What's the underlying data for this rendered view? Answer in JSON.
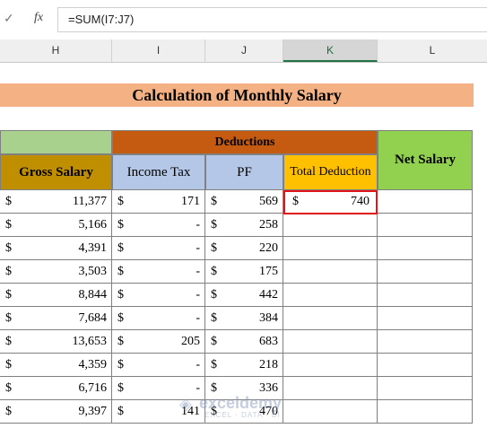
{
  "formula_bar": {
    "cancel_icon": "✓",
    "fx_label": "fx",
    "formula": "=SUM(I7:J7)"
  },
  "columns": [
    "H",
    "I",
    "J",
    "K",
    "L"
  ],
  "active_column": "K",
  "title": "Calculation of Monthly Salary",
  "headers": {
    "deductions": "Deductions",
    "net_salary": "Net Salary",
    "gross_salary": "Gross Salary",
    "income_tax": "Income Tax",
    "pf": "PF",
    "total_deduction": "Total Deduction"
  },
  "currency_symbol": "$",
  "rows": [
    {
      "gross": "11,377",
      "tax": "171",
      "pf": "569",
      "total": "740"
    },
    {
      "gross": "5,166",
      "tax": "-",
      "pf": "258",
      "total": ""
    },
    {
      "gross": "4,391",
      "tax": "-",
      "pf": "220",
      "total": ""
    },
    {
      "gross": "3,503",
      "tax": "-",
      "pf": "175",
      "total": ""
    },
    {
      "gross": "8,844",
      "tax": "-",
      "pf": "442",
      "total": ""
    },
    {
      "gross": "7,684",
      "tax": "-",
      "pf": "384",
      "total": ""
    },
    {
      "gross": "13,653",
      "tax": "205",
      "pf": "683",
      "total": ""
    },
    {
      "gross": "4,359",
      "tax": "-",
      "pf": "218",
      "total": ""
    },
    {
      "gross": "6,716",
      "tax": "-",
      "pf": "336",
      "total": ""
    },
    {
      "gross": "9,397",
      "tax": "141",
      "pf": "470",
      "total": ""
    }
  ],
  "colors": {
    "title_band": "#f4b183",
    "deductions": "#c55a11",
    "net_salary": "#92d050",
    "gross_salary": "#bf8f00",
    "tax_pf": "#b4c7e7",
    "total_deduction": "#ffc000",
    "selection": "#e0161b"
  },
  "watermark": {
    "name": "exceldemy",
    "sub": "EXCEL · DATA · BI"
  }
}
